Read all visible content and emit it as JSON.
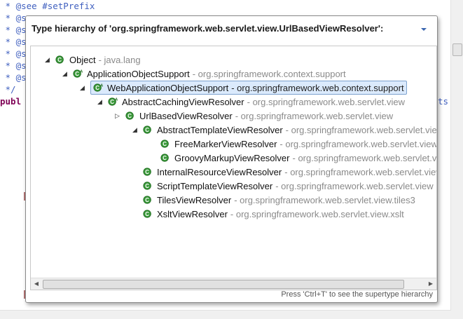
{
  "editor": {
    "lines": [
      " * @see #setPrefix",
      " * @see",
      " * @s",
      " * @s",
      " * @s",
      " * @s",
      " * @s",
      " */",
      "publ"
    ],
    "right_fragment": "ts"
  },
  "popup": {
    "title": "Type hierarchy of 'org.springframework.web.servlet.view.UrlBasedViewResolver':",
    "hint": "Press 'Ctrl+T' to see the supertype hierarchy"
  },
  "tree": [
    {
      "name": "Object",
      "package": "- java.lang",
      "icon": "class-icon",
      "abstract": false
    },
    {
      "name": "ApplicationObjectSupport",
      "package": "- org.springframework.context.support",
      "icon": "class-icon",
      "abstract": true
    },
    {
      "name": "WebApplicationObjectSupport",
      "package": "- org.springframework.web.context.support",
      "icon": "class-icon",
      "abstract": true
    },
    {
      "name": "AbstractCachingViewResolver",
      "package": "- org.springframework.web.servlet.view",
      "icon": "class-icon",
      "abstract": true
    },
    {
      "name": "UrlBasedViewResolver",
      "package": "- org.springframework.web.servlet.view",
      "icon": "class-icon",
      "abstract": false
    },
    {
      "name": "AbstractTemplateViewResolver",
      "package": "- org.springframework.web.servlet.view",
      "icon": "class-icon",
      "abstract": false
    },
    {
      "name": "FreeMarkerViewResolver",
      "package": "- org.springframework.web.servlet.view",
      "icon": "class-icon",
      "abstract": false
    },
    {
      "name": "GroovyMarkupViewResolver",
      "package": "- org.springframework.web.servlet.view",
      "icon": "class-icon",
      "abstract": false
    },
    {
      "name": "InternalResourceViewResolver",
      "package": "- org.springframework.web.servlet.view",
      "icon": "class-icon",
      "abstract": false
    },
    {
      "name": "ScriptTemplateViewResolver",
      "package": "- org.springframework.web.servlet.view",
      "icon": "class-icon",
      "abstract": false
    },
    {
      "name": "TilesViewResolver",
      "package": "- org.springframework.web.servlet.view.tiles3",
      "icon": "class-icon",
      "abstract": false
    },
    {
      "name": "XsltViewResolver",
      "package": "- org.springframework.web.servlet.view.xslt",
      "icon": "class-icon",
      "abstract": false
    }
  ],
  "colors": {
    "class_icon": "#3c9a3c",
    "selection_bg": "#dbeafc",
    "comment": "#3f5fbf",
    "keyword": "#7f0055"
  }
}
